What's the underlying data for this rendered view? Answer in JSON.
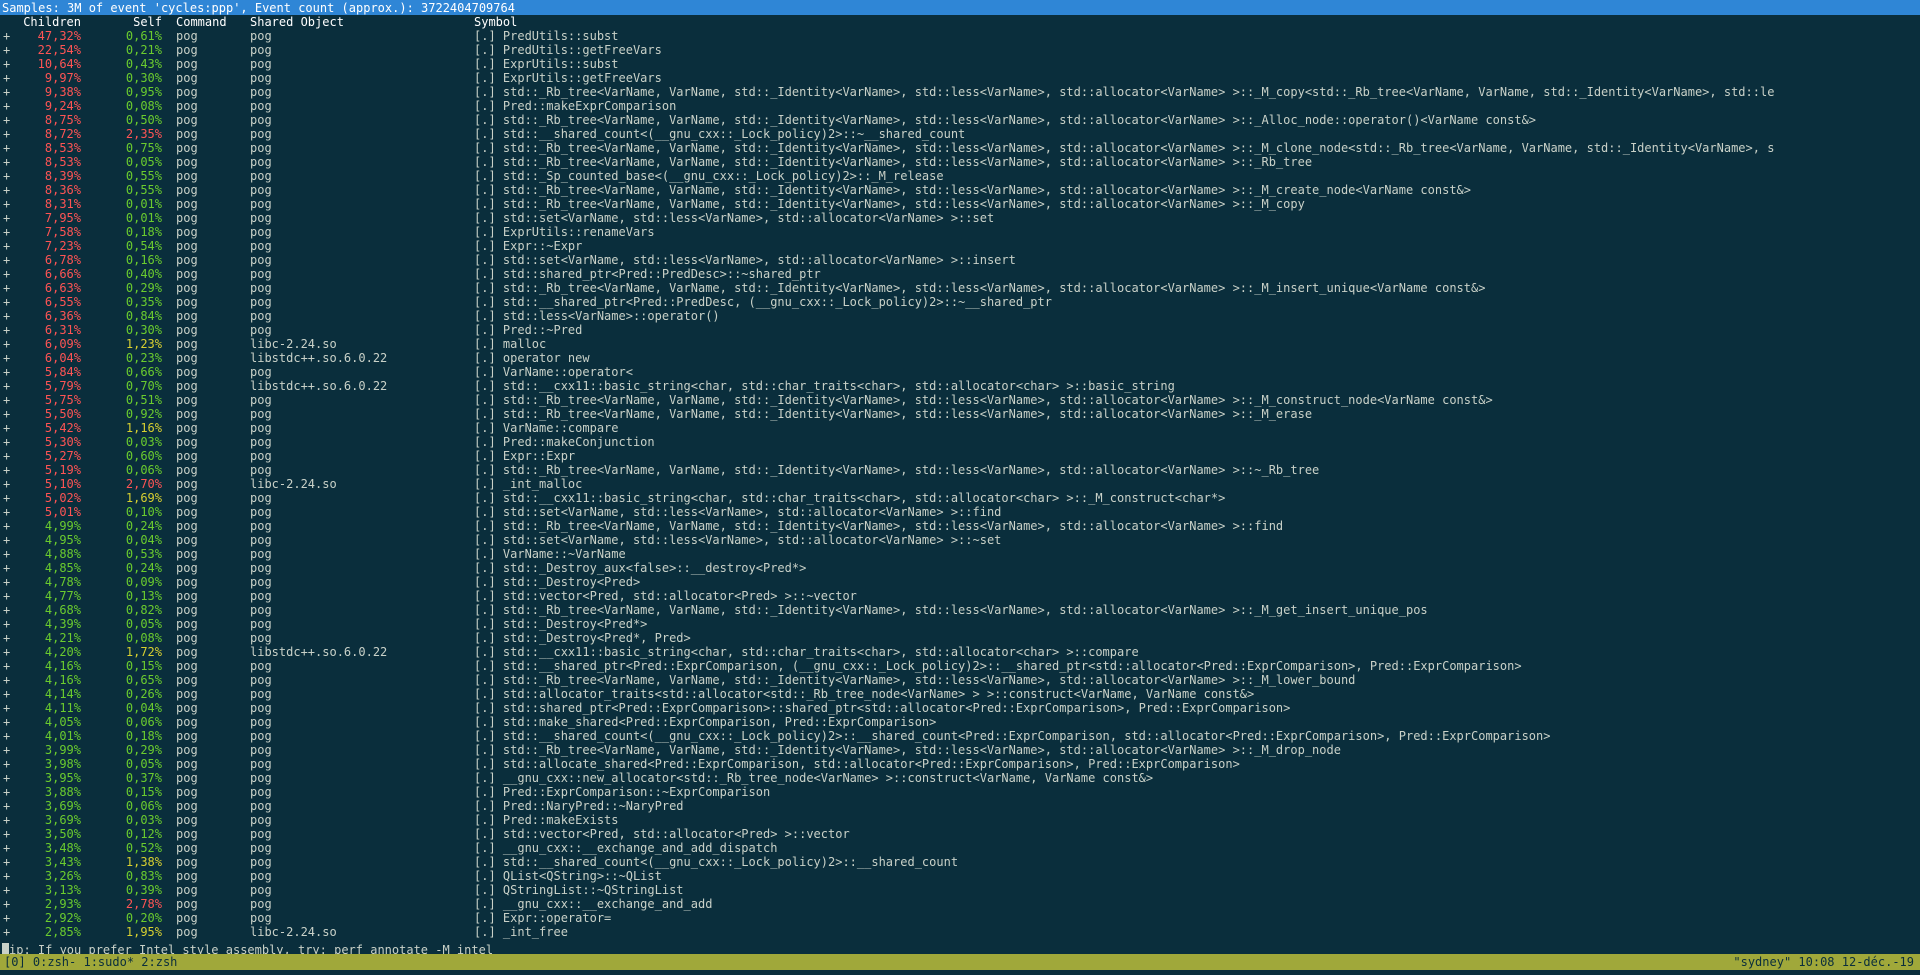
{
  "header": {
    "summary": "Samples: 3M of event 'cycles:ppp', Event count (approx.): 3722404709764"
  },
  "columns": {
    "children": "Children",
    "self": "Self",
    "command": "Command",
    "shared_object": "Shared Object",
    "symbol": "Symbol"
  },
  "colors": {
    "red": "#ff5454",
    "green": "#6bcc2e",
    "yellow": "#d8d030",
    "header_bg": "#2f86d6",
    "status_bg": "#a0a83a",
    "background": "#0a2e3c"
  },
  "rows": [
    {
      "plus": "+",
      "children": "47,32%",
      "self": "0,61%",
      "command": "pog",
      "shared_object": "pog",
      "symbol": "[.] PredUtils::subst",
      "children_color": "red",
      "self_color": "green"
    },
    {
      "plus": "+",
      "children": "22,54%",
      "self": "0,21%",
      "command": "pog",
      "shared_object": "pog",
      "symbol": "[.] PredUtils::getFreeVars",
      "children_color": "red",
      "self_color": "green"
    },
    {
      "plus": "+",
      "children": "10,64%",
      "self": "0,43%",
      "command": "pog",
      "shared_object": "pog",
      "symbol": "[.] ExprUtils::subst",
      "children_color": "red",
      "self_color": "green"
    },
    {
      "plus": "+",
      "children": "9,97%",
      "self": "0,30%",
      "command": "pog",
      "shared_object": "pog",
      "symbol": "[.] ExprUtils::getFreeVars",
      "children_color": "red",
      "self_color": "green"
    },
    {
      "plus": "+",
      "children": "9,38%",
      "self": "0,95%",
      "command": "pog",
      "shared_object": "pog",
      "symbol": "[.] std::_Rb_tree<VarName, VarName, std::_Identity<VarName>, std::less<VarName>, std::allocator<VarName> >::_M_copy<std::_Rb_tree<VarName, VarName, std::_Identity<VarName>, std::le",
      "children_color": "red",
      "self_color": "green"
    },
    {
      "plus": "+",
      "children": "9,24%",
      "self": "0,08%",
      "command": "pog",
      "shared_object": "pog",
      "symbol": "[.] Pred::makeExprComparison",
      "children_color": "red",
      "self_color": "green"
    },
    {
      "plus": "+",
      "children": "8,75%",
      "self": "0,50%",
      "command": "pog",
      "shared_object": "pog",
      "symbol": "[.] std::_Rb_tree<VarName, VarName, std::_Identity<VarName>, std::less<VarName>, std::allocator<VarName> >::_Alloc_node::operator()<VarName const&>",
      "children_color": "red",
      "self_color": "green"
    },
    {
      "plus": "+",
      "children": "8,72%",
      "self": "2,35%",
      "command": "pog",
      "shared_object": "pog",
      "symbol": "[.] std::__shared_count<(__gnu_cxx::_Lock_policy)2>::~__shared_count",
      "children_color": "red",
      "self_color": "red"
    },
    {
      "plus": "+",
      "children": "8,53%",
      "self": "0,75%",
      "command": "pog",
      "shared_object": "pog",
      "symbol": "[.] std::_Rb_tree<VarName, VarName, std::_Identity<VarName>, std::less<VarName>, std::allocator<VarName> >::_M_clone_node<std::_Rb_tree<VarName, VarName, std::_Identity<VarName>, s",
      "children_color": "red",
      "self_color": "green"
    },
    {
      "plus": "+",
      "children": "8,53%",
      "self": "0,05%",
      "command": "pog",
      "shared_object": "pog",
      "symbol": "[.] std::_Rb_tree<VarName, VarName, std::_Identity<VarName>, std::less<VarName>, std::allocator<VarName> >::_Rb_tree",
      "children_color": "red",
      "self_color": "green"
    },
    {
      "plus": "+",
      "children": "8,39%",
      "self": "0,55%",
      "command": "pog",
      "shared_object": "pog",
      "symbol": "[.] std::_Sp_counted_base<(__gnu_cxx::_Lock_policy)2>::_M_release",
      "children_color": "red",
      "self_color": "green"
    },
    {
      "plus": "+",
      "children": "8,36%",
      "self": "0,55%",
      "command": "pog",
      "shared_object": "pog",
      "symbol": "[.] std::_Rb_tree<VarName, VarName, std::_Identity<VarName>, std::less<VarName>, std::allocator<VarName> >::_M_create_node<VarName const&>",
      "children_color": "red",
      "self_color": "green"
    },
    {
      "plus": "+",
      "children": "8,31%",
      "self": "0,01%",
      "command": "pog",
      "shared_object": "pog",
      "symbol": "[.] std::_Rb_tree<VarName, VarName, std::_Identity<VarName>, std::less<VarName>, std::allocator<VarName> >::_M_copy",
      "children_color": "red",
      "self_color": "green"
    },
    {
      "plus": "+",
      "children": "7,95%",
      "self": "0,01%",
      "command": "pog",
      "shared_object": "pog",
      "symbol": "[.] std::set<VarName, std::less<VarName>, std::allocator<VarName> >::set",
      "children_color": "red",
      "self_color": "green"
    },
    {
      "plus": "+",
      "children": "7,58%",
      "self": "0,18%",
      "command": "pog",
      "shared_object": "pog",
      "symbol": "[.] ExprUtils::renameVars",
      "children_color": "red",
      "self_color": "green"
    },
    {
      "plus": "+",
      "children": "7,23%",
      "self": "0,54%",
      "command": "pog",
      "shared_object": "pog",
      "symbol": "[.] Expr::~Expr",
      "children_color": "red",
      "self_color": "green"
    },
    {
      "plus": "+",
      "children": "6,78%",
      "self": "0,16%",
      "command": "pog",
      "shared_object": "pog",
      "symbol": "[.] std::set<VarName, std::less<VarName>, std::allocator<VarName> >::insert",
      "children_color": "red",
      "self_color": "green"
    },
    {
      "plus": "+",
      "children": "6,66%",
      "self": "0,40%",
      "command": "pog",
      "shared_object": "pog",
      "symbol": "[.] std::shared_ptr<Pred::PredDesc>::~shared_ptr",
      "children_color": "red",
      "self_color": "green"
    },
    {
      "plus": "+",
      "children": "6,63%",
      "self": "0,29%",
      "command": "pog",
      "shared_object": "pog",
      "symbol": "[.] std::_Rb_tree<VarName, VarName, std::_Identity<VarName>, std::less<VarName>, std::allocator<VarName> >::_M_insert_unique<VarName const&>",
      "children_color": "red",
      "self_color": "green"
    },
    {
      "plus": "+",
      "children": "6,55%",
      "self": "0,35%",
      "command": "pog",
      "shared_object": "pog",
      "symbol": "[.] std::__shared_ptr<Pred::PredDesc, (__gnu_cxx::_Lock_policy)2>::~__shared_ptr",
      "children_color": "red",
      "self_color": "green"
    },
    {
      "plus": "+",
      "children": "6,36%",
      "self": "0,84%",
      "command": "pog",
      "shared_object": "pog",
      "symbol": "[.] std::less<VarName>::operator()",
      "children_color": "red",
      "self_color": "green"
    },
    {
      "plus": "+",
      "children": "6,31%",
      "self": "0,30%",
      "command": "pog",
      "shared_object": "pog",
      "symbol": "[.] Pred::~Pred",
      "children_color": "red",
      "self_color": "green"
    },
    {
      "plus": "+",
      "children": "6,09%",
      "self": "1,23%",
      "command": "pog",
      "shared_object": "libc-2.24.so",
      "symbol": "[.] malloc",
      "children_color": "red",
      "self_color": "yellow"
    },
    {
      "plus": "+",
      "children": "6,04%",
      "self": "0,23%",
      "command": "pog",
      "shared_object": "libstdc++.so.6.0.22",
      "symbol": "[.] operator new",
      "children_color": "red",
      "self_color": "green"
    },
    {
      "plus": "+",
      "children": "5,84%",
      "self": "0,66%",
      "command": "pog",
      "shared_object": "pog",
      "symbol": "[.] VarName::operator<",
      "children_color": "red",
      "self_color": "green"
    },
    {
      "plus": "+",
      "children": "5,79%",
      "self": "0,70%",
      "command": "pog",
      "shared_object": "libstdc++.so.6.0.22",
      "symbol": "[.] std::__cxx11::basic_string<char, std::char_traits<char>, std::allocator<char> >::basic_string",
      "children_color": "red",
      "self_color": "green"
    },
    {
      "plus": "+",
      "children": "5,75%",
      "self": "0,51%",
      "command": "pog",
      "shared_object": "pog",
      "symbol": "[.] std::_Rb_tree<VarName, VarName, std::_Identity<VarName>, std::less<VarName>, std::allocator<VarName> >::_M_construct_node<VarName const&>",
      "children_color": "red",
      "self_color": "green"
    },
    {
      "plus": "+",
      "children": "5,50%",
      "self": "0,92%",
      "command": "pog",
      "shared_object": "pog",
      "symbol": "[.] std::_Rb_tree<VarName, VarName, std::_Identity<VarName>, std::less<VarName>, std::allocator<VarName> >::_M_erase",
      "children_color": "red",
      "self_color": "green"
    },
    {
      "plus": "+",
      "children": "5,42%",
      "self": "1,16%",
      "command": "pog",
      "shared_object": "pog",
      "symbol": "[.] VarName::compare",
      "children_color": "red",
      "self_color": "yellow"
    },
    {
      "plus": "+",
      "children": "5,30%",
      "self": "0,03%",
      "command": "pog",
      "shared_object": "pog",
      "symbol": "[.] Pred::makeConjunction",
      "children_color": "red",
      "self_color": "green"
    },
    {
      "plus": "+",
      "children": "5,27%",
      "self": "0,60%",
      "command": "pog",
      "shared_object": "pog",
      "symbol": "[.] Expr::Expr",
      "children_color": "red",
      "self_color": "green"
    },
    {
      "plus": "+",
      "children": "5,19%",
      "self": "0,06%",
      "command": "pog",
      "shared_object": "pog",
      "symbol": "[.] std::_Rb_tree<VarName, VarName, std::_Identity<VarName>, std::less<VarName>, std::allocator<VarName> >::~_Rb_tree",
      "children_color": "red",
      "self_color": "green"
    },
    {
      "plus": "+",
      "children": "5,10%",
      "self": "2,70%",
      "command": "pog",
      "shared_object": "libc-2.24.so",
      "symbol": "[.] _int_malloc",
      "children_color": "red",
      "self_color": "red"
    },
    {
      "plus": "+",
      "children": "5,02%",
      "self": "1,69%",
      "command": "pog",
      "shared_object": "pog",
      "symbol": "[.] std::__cxx11::basic_string<char, std::char_traits<char>, std::allocator<char> >::_M_construct<char*>",
      "children_color": "red",
      "self_color": "yellow"
    },
    {
      "plus": "+",
      "children": "5,01%",
      "self": "0,10%",
      "command": "pog",
      "shared_object": "pog",
      "symbol": "[.] std::set<VarName, std::less<VarName>, std::allocator<VarName> >::find",
      "children_color": "red",
      "self_color": "green"
    },
    {
      "plus": "+",
      "children": "4,99%",
      "self": "0,24%",
      "command": "pog",
      "shared_object": "pog",
      "symbol": "[.] std::_Rb_tree<VarName, VarName, std::_Identity<VarName>, std::less<VarName>, std::allocator<VarName> >::find",
      "children_color": "green",
      "self_color": "green"
    },
    {
      "plus": "+",
      "children": "4,95%",
      "self": "0,04%",
      "command": "pog",
      "shared_object": "pog",
      "symbol": "[.] std::set<VarName, std::less<VarName>, std::allocator<VarName> >::~set",
      "children_color": "green",
      "self_color": "green"
    },
    {
      "plus": "+",
      "children": "4,88%",
      "self": "0,53%",
      "command": "pog",
      "shared_object": "pog",
      "symbol": "[.] VarName::~VarName",
      "children_color": "green",
      "self_color": "green"
    },
    {
      "plus": "+",
      "children": "4,85%",
      "self": "0,24%",
      "command": "pog",
      "shared_object": "pog",
      "symbol": "[.] std::_Destroy_aux<false>::__destroy<Pred*>",
      "children_color": "green",
      "self_color": "green"
    },
    {
      "plus": "+",
      "children": "4,78%",
      "self": "0,09%",
      "command": "pog",
      "shared_object": "pog",
      "symbol": "[.] std::_Destroy<Pred>",
      "children_color": "green",
      "self_color": "green"
    },
    {
      "plus": "+",
      "children": "4,77%",
      "self": "0,13%",
      "command": "pog",
      "shared_object": "pog",
      "symbol": "[.] std::vector<Pred, std::allocator<Pred> >::~vector",
      "children_color": "green",
      "self_color": "green"
    },
    {
      "plus": "+",
      "children": "4,68%",
      "self": "0,82%",
      "command": "pog",
      "shared_object": "pog",
      "symbol": "[.] std::_Rb_tree<VarName, VarName, std::_Identity<VarName>, std::less<VarName>, std::allocator<VarName> >::_M_get_insert_unique_pos",
      "children_color": "green",
      "self_color": "green"
    },
    {
      "plus": "+",
      "children": "4,39%",
      "self": "0,05%",
      "command": "pog",
      "shared_object": "pog",
      "symbol": "[.] std::_Destroy<Pred*>",
      "children_color": "green",
      "self_color": "green"
    },
    {
      "plus": "+",
      "children": "4,21%",
      "self": "0,08%",
      "command": "pog",
      "shared_object": "pog",
      "symbol": "[.] std::_Destroy<Pred*, Pred>",
      "children_color": "green",
      "self_color": "green"
    },
    {
      "plus": "+",
      "children": "4,20%",
      "self": "1,72%",
      "command": "pog",
      "shared_object": "libstdc++.so.6.0.22",
      "symbol": "[.] std::__cxx11::basic_string<char, std::char_traits<char>, std::allocator<char> >::compare",
      "children_color": "green",
      "self_color": "yellow"
    },
    {
      "plus": "+",
      "children": "4,16%",
      "self": "0,15%",
      "command": "pog",
      "shared_object": "pog",
      "symbol": "[.] std::__shared_ptr<Pred::ExprComparison, (__gnu_cxx::_Lock_policy)2>::__shared_ptr<std::allocator<Pred::ExprComparison>, Pred::ExprComparison>",
      "children_color": "green",
      "self_color": "green"
    },
    {
      "plus": "+",
      "children": "4,16%",
      "self": "0,65%",
      "command": "pog",
      "shared_object": "pog",
      "symbol": "[.] std::_Rb_tree<VarName, VarName, std::_Identity<VarName>, std::less<VarName>, std::allocator<VarName> >::_M_lower_bound",
      "children_color": "green",
      "self_color": "green"
    },
    {
      "plus": "+",
      "children": "4,14%",
      "self": "0,26%",
      "command": "pog",
      "shared_object": "pog",
      "symbol": "[.] std::allocator_traits<std::allocator<std::_Rb_tree_node<VarName> > >::construct<VarName, VarName const&>",
      "children_color": "green",
      "self_color": "green"
    },
    {
      "plus": "+",
      "children": "4,11%",
      "self": "0,04%",
      "command": "pog",
      "shared_object": "pog",
      "symbol": "[.] std::shared_ptr<Pred::ExprComparison>::shared_ptr<std::allocator<Pred::ExprComparison>, Pred::ExprComparison>",
      "children_color": "green",
      "self_color": "green"
    },
    {
      "plus": "+",
      "children": "4,05%",
      "self": "0,06%",
      "command": "pog",
      "shared_object": "pog",
      "symbol": "[.] std::make_shared<Pred::ExprComparison, Pred::ExprComparison>",
      "children_color": "green",
      "self_color": "green"
    },
    {
      "plus": "+",
      "children": "4,01%",
      "self": "0,18%",
      "command": "pog",
      "shared_object": "pog",
      "symbol": "[.] std::__shared_count<(__gnu_cxx::_Lock_policy)2>::__shared_count<Pred::ExprComparison, std::allocator<Pred::ExprComparison>, Pred::ExprComparison>",
      "children_color": "green",
      "self_color": "green"
    },
    {
      "plus": "+",
      "children": "3,99%",
      "self": "0,29%",
      "command": "pog",
      "shared_object": "pog",
      "symbol": "[.] std::_Rb_tree<VarName, VarName, std::_Identity<VarName>, std::less<VarName>, std::allocator<VarName> >::_M_drop_node",
      "children_color": "green",
      "self_color": "green"
    },
    {
      "plus": "+",
      "children": "3,98%",
      "self": "0,05%",
      "command": "pog",
      "shared_object": "pog",
      "symbol": "[.] std::allocate_shared<Pred::ExprComparison, std::allocator<Pred::ExprComparison>, Pred::ExprComparison>",
      "children_color": "green",
      "self_color": "green"
    },
    {
      "plus": "+",
      "children": "3,95%",
      "self": "0,37%",
      "command": "pog",
      "shared_object": "pog",
      "symbol": "[.] __gnu_cxx::new_allocator<std::_Rb_tree_node<VarName> >::construct<VarName, VarName const&>",
      "children_color": "green",
      "self_color": "green"
    },
    {
      "plus": "+",
      "children": "3,88%",
      "self": "0,15%",
      "command": "pog",
      "shared_object": "pog",
      "symbol": "[.] Pred::ExprComparison::~ExprComparison",
      "children_color": "green",
      "self_color": "green"
    },
    {
      "plus": "+",
      "children": "3,69%",
      "self": "0,06%",
      "command": "pog",
      "shared_object": "pog",
      "symbol": "[.] Pred::NaryPred::~NaryPred",
      "children_color": "green",
      "self_color": "green"
    },
    {
      "plus": "+",
      "children": "3,69%",
      "self": "0,03%",
      "command": "pog",
      "shared_object": "pog",
      "symbol": "[.] Pred::makeExists",
      "children_color": "green",
      "self_color": "green"
    },
    {
      "plus": "+",
      "children": "3,50%",
      "self": "0,12%",
      "command": "pog",
      "shared_object": "pog",
      "symbol": "[.] std::vector<Pred, std::allocator<Pred> >::vector",
      "children_color": "green",
      "self_color": "green"
    },
    {
      "plus": "+",
      "children": "3,48%",
      "self": "0,52%",
      "command": "pog",
      "shared_object": "pog",
      "symbol": "[.] __gnu_cxx::__exchange_and_add_dispatch",
      "children_color": "green",
      "self_color": "green"
    },
    {
      "plus": "+",
      "children": "3,43%",
      "self": "1,38%",
      "command": "pog",
      "shared_object": "pog",
      "symbol": "[.] std::__shared_count<(__gnu_cxx::_Lock_policy)2>::__shared_count",
      "children_color": "green",
      "self_color": "yellow"
    },
    {
      "plus": "+",
      "children": "3,26%",
      "self": "0,83%",
      "command": "pog",
      "shared_object": "pog",
      "symbol": "[.] QList<QString>::~QList",
      "children_color": "green",
      "self_color": "green"
    },
    {
      "plus": "+",
      "children": "3,13%",
      "self": "0,39%",
      "command": "pog",
      "shared_object": "pog",
      "symbol": "[.] QStringList::~QStringList",
      "children_color": "green",
      "self_color": "green"
    },
    {
      "plus": "+",
      "children": "2,93%",
      "self": "2,78%",
      "command": "pog",
      "shared_object": "pog",
      "symbol": "[.] __gnu_cxx::__exchange_and_add",
      "children_color": "green",
      "self_color": "red"
    },
    {
      "plus": "+",
      "children": "2,92%",
      "self": "0,20%",
      "command": "pog",
      "shared_object": "pog",
      "symbol": "[.] Expr::operator=",
      "children_color": "green",
      "self_color": "green"
    },
    {
      "plus": "+",
      "children": "2,85%",
      "self": "1,95%",
      "command": "pog",
      "shared_object": "libc-2.24.so",
      "symbol": "[.] _int_free",
      "children_color": "green",
      "self_color": "yellow"
    }
  ],
  "tip": {
    "text": "ip: If you prefer Intel style assembly, try: perf annotate -M intel"
  },
  "status_bar": {
    "left": "[0] 0:zsh- 1:sudo* 2:zsh",
    "right": "\"sydney\" 10:08 12-déc.-19"
  }
}
